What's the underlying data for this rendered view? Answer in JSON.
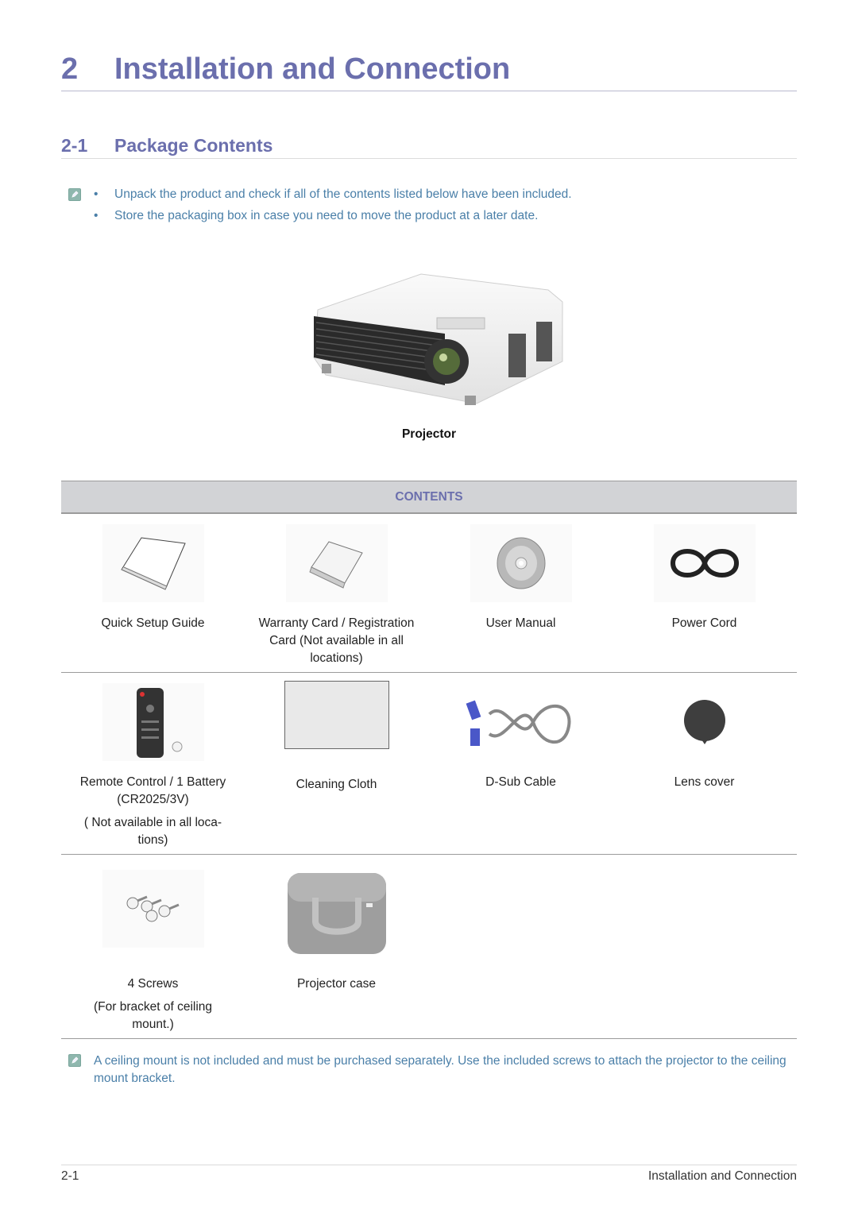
{
  "chapter": {
    "number": "2",
    "title": "Installation and Connection"
  },
  "section": {
    "number": "2-1",
    "title": "Package Contents"
  },
  "notes": {
    "icon": "note-pencil-icon",
    "bullets": [
      "Unpack the product and check if all of the contents listed below have been included.",
      "Store the packaging box in case you need to move the product at a later date."
    ]
  },
  "main_product": {
    "label": "Projector",
    "image": "projector-image"
  },
  "contents_header": "CONTENTS",
  "items": [
    {
      "label": "Quick Setup Guide",
      "sub": "",
      "image": "booklet-image"
    },
    {
      "label": "Warranty Card / Registration Card (Not available in all locations)",
      "sub": "",
      "image": "card-image"
    },
    {
      "label": "User Manual",
      "sub": "",
      "image": "cd-image"
    },
    {
      "label": "Power Cord",
      "sub": "",
      "image": "power-cord-image"
    },
    {
      "label": "Remote Control / 1 Battery (CR2025/3V)",
      "sub": "( Not available in all loca-tions)",
      "image": "remote-image"
    },
    {
      "label": "Cleaning Cloth",
      "sub": "",
      "image": "cloth-image"
    },
    {
      "label": "D-Sub Cable",
      "sub": "",
      "image": "dsub-cable-image"
    },
    {
      "label": "Lens cover",
      "sub": "",
      "image": "lens-cover-image"
    },
    {
      "label": "4 Screws",
      "sub": "(For bracket of ceiling mount.)",
      "image": "screws-image"
    },
    {
      "label": "Projector case",
      "sub": "",
      "image": "case-image"
    }
  ],
  "bottom_note": "A ceiling mount is not included and must be purchased separately. Use the included screws to attach the projector to the ceiling mount bracket.",
  "footer": {
    "page": "2-1",
    "chapter": "Installation and Connection"
  }
}
